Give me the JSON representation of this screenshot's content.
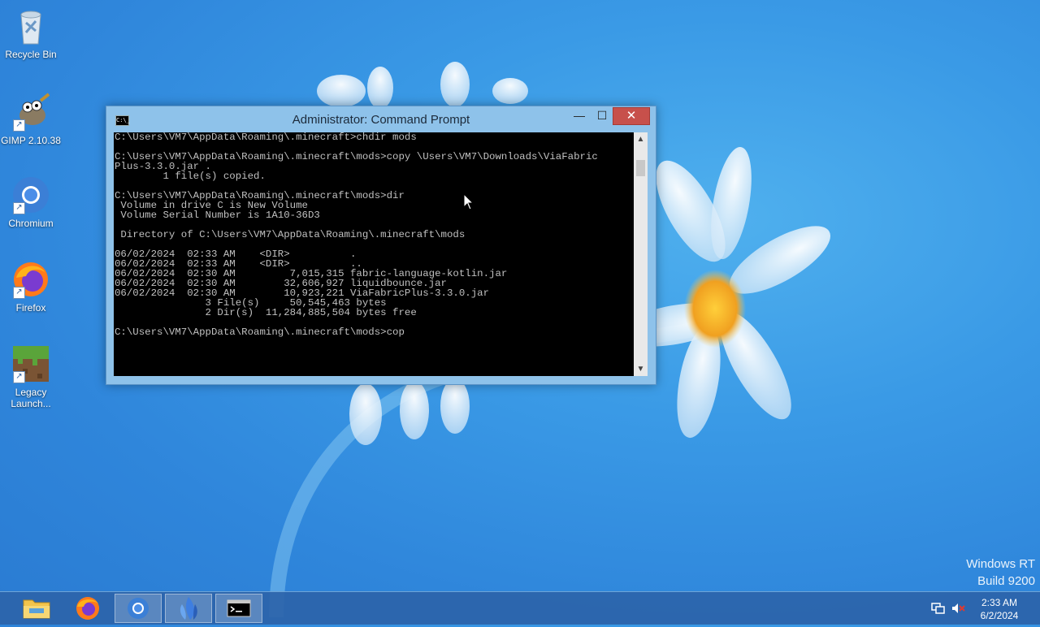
{
  "desktop": {
    "icons": [
      {
        "label": "Recycle Bin"
      },
      {
        "label": "GIMP 2.10.38"
      },
      {
        "label": "Chromium"
      },
      {
        "label": "Firefox"
      },
      {
        "label": "Legacy Launch..."
      }
    ],
    "watermark": {
      "line1": "Windows RT",
      "line2": "Build 9200"
    }
  },
  "window": {
    "title": "Administrator: Command Prompt",
    "icon_text": "C:\\_",
    "console_lines": [
      "C:\\Users\\VM7\\AppData\\Roaming\\.minecraft>chdir mods",
      "",
      "C:\\Users\\VM7\\AppData\\Roaming\\.minecraft\\mods>copy \\Users\\VM7\\Downloads\\ViaFabric",
      "Plus-3.3.0.jar .",
      "        1 file(s) copied.",
      "",
      "C:\\Users\\VM7\\AppData\\Roaming\\.minecraft\\mods>dir",
      " Volume in drive C is New Volume",
      " Volume Serial Number is 1A10-36D3",
      "",
      " Directory of C:\\Users\\VM7\\AppData\\Roaming\\.minecraft\\mods",
      "",
      "06/02/2024  02:33 AM    <DIR>          .",
      "06/02/2024  02:33 AM    <DIR>          ..",
      "06/02/2024  02:30 AM         7,015,315 fabric-language-kotlin.jar",
      "06/02/2024  02:30 AM        32,606,927 liquidbounce.jar",
      "06/02/2024  02:30 AM        10,923,221 ViaFabricPlus-3.3.0.jar",
      "               3 File(s)     50,545,463 bytes",
      "               2 Dir(s)  11,284,885,504 bytes free",
      "",
      "C:\\Users\\VM7\\AppData\\Roaming\\.minecraft\\mods>cop"
    ]
  },
  "taskbar": {
    "clock_time": "2:33 AM",
    "clock_date": "6/2/2024"
  },
  "colors": {
    "desktop_bg": "#3a9ae6",
    "close_button": "#c7504b",
    "taskbar": "#2c64aa"
  }
}
